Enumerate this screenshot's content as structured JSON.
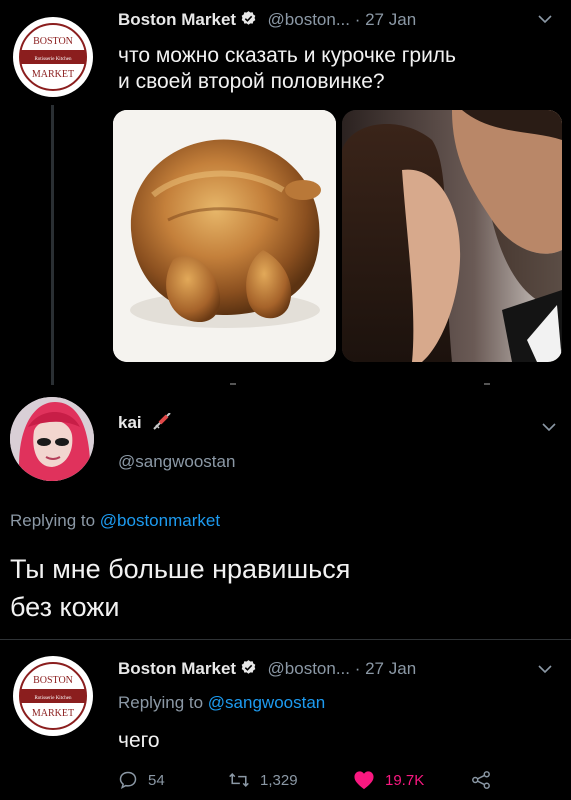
{
  "tweet1": {
    "author_name": "Boston Market",
    "handle_time": "@boston... · 27 Jan",
    "text_line1": "что можно сказать и курочке гриль",
    "text_line2": "и своей второй половинке?"
  },
  "reply1": {
    "author_name": "kai",
    "handle": "@sangwoostan",
    "replying_prefix": "Replying to",
    "replying_handle": "@bostonmarket",
    "text_line1": "Ты мне больше нравишься",
    "text_line2": "без кожи"
  },
  "tweet2": {
    "author_name": "Boston Market",
    "handle_time": "@boston... · 27 Jan",
    "replying_prefix": "Replying to",
    "replying_handle": "@sangwoostan",
    "text": "чего",
    "replies_count": "54",
    "retweets_count": "1,329",
    "likes_count": "19.7K"
  },
  "logo": {
    "top_text": "BOSTON",
    "middle_text": "Rotisserie Kitchen",
    "bottom_text": "MARKET"
  },
  "colors": {
    "background": "#000000",
    "link": "#1d9bf0",
    "muted": "#8b98a5",
    "like": "#f91880",
    "brand_red": "#8b1e1e"
  }
}
